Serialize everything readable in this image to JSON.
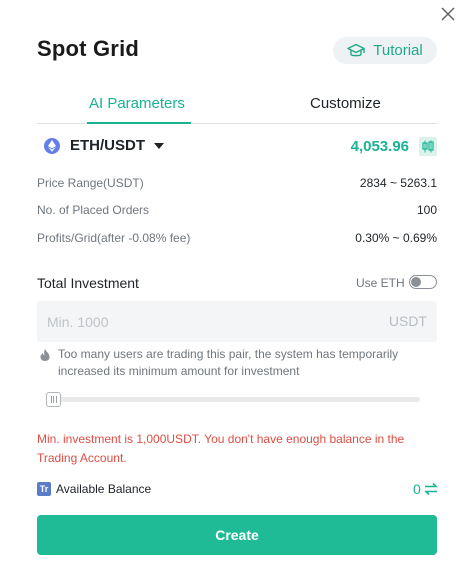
{
  "title": "Spot Grid",
  "tutorial": {
    "label": "Tutorial",
    "icon": "graduation-cap-icon"
  },
  "tabs": [
    {
      "label": "AI Parameters",
      "active": true
    },
    {
      "label": "Customize",
      "active": false
    }
  ],
  "pair": {
    "name": "ETH/USDT",
    "price": "4,053.96",
    "icon": "ethereum-icon"
  },
  "info": [
    {
      "key": "Price Range(USDT)",
      "value": "2834 ~ 5263.1"
    },
    {
      "key": "No. of Placed Orders",
      "value": "100"
    },
    {
      "key": "Profits/Grid(after -0.08% fee)",
      "value": "0.30% ~ 0.69%"
    }
  ],
  "investment": {
    "label": "Total Investment",
    "use_eth_label": "Use ETH",
    "use_eth_enabled": false,
    "placeholder": "Min. 1000",
    "unit": "USDT",
    "notice": "Too many users are trading this pair, the system has temporarily increased its minimum amount for investment",
    "slider_percent": 0
  },
  "error": "Min. investment is 1,000USDT. You don't have enough balance in the Trading Account.",
  "balance": {
    "label": "Available Balance",
    "value": "0"
  },
  "create_label": "Create",
  "colors": {
    "accent": "#19b393",
    "error": "#dd4e44",
    "button": "#1fba96"
  }
}
